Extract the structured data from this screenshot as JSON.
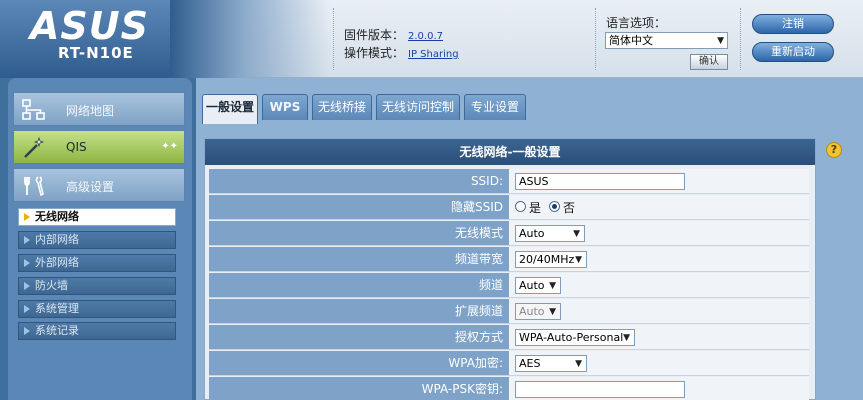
{
  "header": {
    "brand": "ASUS",
    "model": "RT-N10E",
    "firmware_label": "固件版本：",
    "firmware_value": "2.0.0.7",
    "mode_label": "操作模式：",
    "mode_value": "IP Sharing",
    "language_label": "语言选项：",
    "language_value": "简体中文",
    "apply_label": "确认",
    "logout_label": "注销",
    "reboot_label": "重新启动"
  },
  "sidebar": {
    "main_items": [
      {
        "label": "网络地图",
        "icon": "network-map-icon"
      },
      {
        "label": "QIS",
        "icon": "magic-wand-icon"
      },
      {
        "label": "高级设置",
        "icon": "tools-icon"
      }
    ],
    "sub_items": [
      {
        "label": "无线网络",
        "active": true
      },
      {
        "label": "内部网络",
        "active": false
      },
      {
        "label": "外部网络",
        "active": false
      },
      {
        "label": "防火墙",
        "active": false
      },
      {
        "label": "系统管理",
        "active": false
      },
      {
        "label": "系统记录",
        "active": false
      }
    ]
  },
  "tabs": [
    {
      "label": "一般设置",
      "active": true
    },
    {
      "label": "WPS",
      "active": false
    },
    {
      "label": "无线桥接",
      "active": false
    },
    {
      "label": "无线访问控制",
      "active": false
    },
    {
      "label": "专业设置",
      "active": false
    }
  ],
  "panel": {
    "title": "无线网络-一般设置",
    "help": "?",
    "fields": {
      "ssid": {
        "label": "SSID:",
        "value": "ASUS"
      },
      "hide_ssid": {
        "label": "隐藏SSID",
        "yes": "是",
        "no": "否",
        "selected": "no"
      },
      "wireless_mode": {
        "label": "无线模式",
        "value": "Auto"
      },
      "channel_bandwidth": {
        "label": "频道带宽",
        "value": "20/40MHz"
      },
      "channel": {
        "label": "频道",
        "value": "Auto"
      },
      "extension_channel": {
        "label": "扩展频道",
        "value": "Auto"
      },
      "auth_method": {
        "label": "授权方式",
        "value": "WPA-Auto-Personal"
      },
      "wpa_encryption": {
        "label": "WPA加密:",
        "value": "AES"
      },
      "wpa_psk": {
        "label": "WPA-PSK密钥:",
        "value": ""
      }
    }
  }
}
